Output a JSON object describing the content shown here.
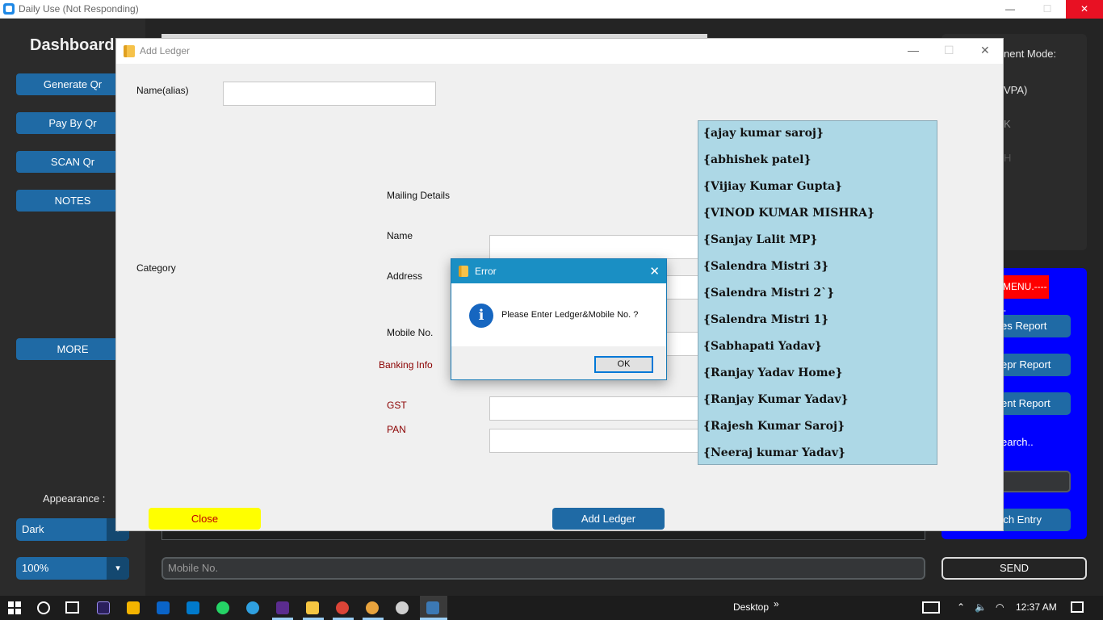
{
  "main_window": {
    "title": "Daily Use (Not Responding)",
    "minimize": "—",
    "maximize": "☐",
    "close": "✕"
  },
  "sidebar": {
    "title": "Dashboard",
    "buttons": [
      "Generate Qr",
      "Pay By Qr",
      "SCAN Qr",
      "NOTES",
      "MORE"
    ],
    "appearance_label": "Appearance :",
    "appearance_value": "Dark",
    "scaling_value": "100%"
  },
  "right_panel": {
    "payment_mode_label": "nent Mode:",
    "option_1": "VPA)",
    "option_2": "K",
    "option_3": "H",
    "menu_badge": "MENU.-----",
    "report_buttons": [
      "es Report",
      "epr Report",
      "ent Report"
    ],
    "search_label": "earch..",
    "search_button": "rch Entry"
  },
  "bottom": {
    "mobile_placeholder": "Mobile No.",
    "send_label": "SEND"
  },
  "ledger_dialog": {
    "title": "Add Ledger",
    "labels": {
      "alias": "Name(alias)",
      "category": "Category",
      "mailing": "Mailing Details",
      "name": "Name",
      "address": "Address",
      "mobile": "Mobile No.",
      "banking": "Banking Info",
      "gst": "GST",
      "pan": "PAN"
    },
    "close_button": "Close",
    "add_button": "Add Ledger"
  },
  "suggestions": [
    "{ajay kumar saroj}",
    "{abhishek patel}",
    "{Vijiay Kumar Gupta}",
    "{VINOD KUMAR MISHRA}",
    "{Sanjay Lalit MP}",
    "{Salendra Mistri 3}",
    "{Salendra Mistri 2`}",
    "{Salendra Mistri 1}",
    "{Sabhapati Yadav}",
    "{Ranjay Yadav Home}",
    "{Ranjay Kumar Yadav}",
    "{Rajesh Kumar Saroj}",
    "{Neeraj kumar Yadav}"
  ],
  "error_dialog": {
    "title": "Error",
    "message": "Please Enter Ledger&Mobile No. ?",
    "icon": "i",
    "ok": "OK"
  },
  "taskbar": {
    "desktop_label": "Desktop",
    "chevron": "»",
    "time": "12:37 AM"
  }
}
